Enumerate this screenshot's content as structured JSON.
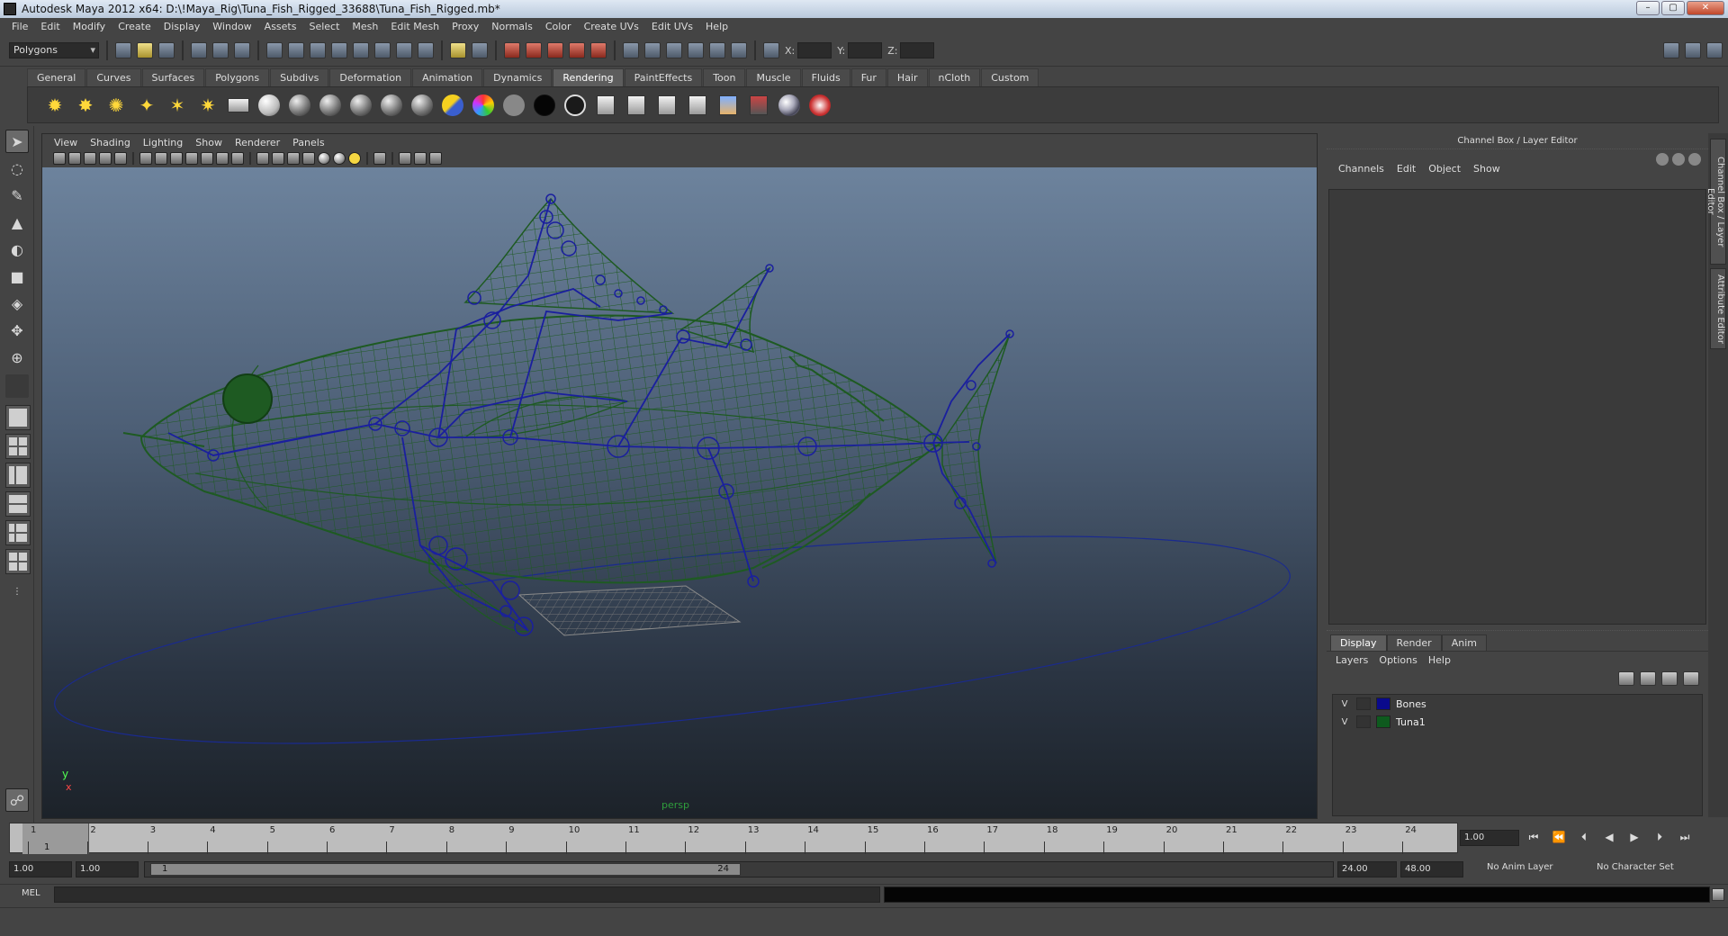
{
  "window": {
    "title": "Autodesk Maya 2012 x64: D:\\!Maya_Rig\\Tuna_Fish_Rigged_33688\\Tuna_Fish_Rigged.mb*"
  },
  "menubar": [
    "File",
    "Edit",
    "Modify",
    "Create",
    "Display",
    "Window",
    "Assets",
    "Select",
    "Mesh",
    "Edit Mesh",
    "Proxy",
    "Normals",
    "Color",
    "Create UVs",
    "Edit UVs",
    "Help"
  ],
  "statusline": {
    "mode": "Polygons",
    "x_label": "X:",
    "y_label": "Y:",
    "z_label": "Z:"
  },
  "shelf": {
    "tabs": [
      "General",
      "Curves",
      "Surfaces",
      "Polygons",
      "Subdivs",
      "Deformation",
      "Animation",
      "Dynamics",
      "Rendering",
      "PaintEffects",
      "Toon",
      "Muscle",
      "Fluids",
      "Fur",
      "Hair",
      "nCloth",
      "Custom"
    ],
    "active_tab": "Rendering"
  },
  "viewport": {
    "menu": [
      "View",
      "Shading",
      "Lighting",
      "Show",
      "Renderer",
      "Panels"
    ],
    "camera_label": "persp",
    "axis_y": "y",
    "axis_x": "x",
    "colors": {
      "mesh": "#1e5a22",
      "joints": "#1a1f9e",
      "background_top": "#6d839d",
      "background_bottom": "#1c2229"
    }
  },
  "channel_box": {
    "title": "Channel Box / Layer Editor",
    "menu": [
      "Channels",
      "Edit",
      "Object",
      "Show"
    ]
  },
  "side_tabs": [
    "Channel Box / Layer Editor",
    "Attribute Editor"
  ],
  "layer_editor": {
    "tabs": [
      "Display",
      "Render",
      "Anim"
    ],
    "active_tab": "Display",
    "menu": [
      "Layers",
      "Options",
      "Help"
    ],
    "layers": [
      {
        "visible": "V",
        "name": "Bones",
        "color": "#0a0a8c"
      },
      {
        "visible": "V",
        "name": "Tuna1",
        "color": "#0e5a1e"
      }
    ]
  },
  "timeline": {
    "ticks": [
      "1",
      "2",
      "3",
      "4",
      "5",
      "6",
      "7",
      "8",
      "9",
      "10",
      "11",
      "12",
      "13",
      "14",
      "15",
      "16",
      "17",
      "18",
      "19",
      "20",
      "21",
      "22",
      "23",
      "24"
    ],
    "current_frame": "1",
    "current_time": "1.00"
  },
  "range": {
    "start_time": "1.00",
    "playback_start": "1.00",
    "range_start": "1",
    "range_end": "24",
    "playback_end": "24.00",
    "end_time": "48.00",
    "anim_layer": "No Anim Layer",
    "character_set": "No Character Set"
  },
  "command_line": {
    "label": "MEL"
  }
}
